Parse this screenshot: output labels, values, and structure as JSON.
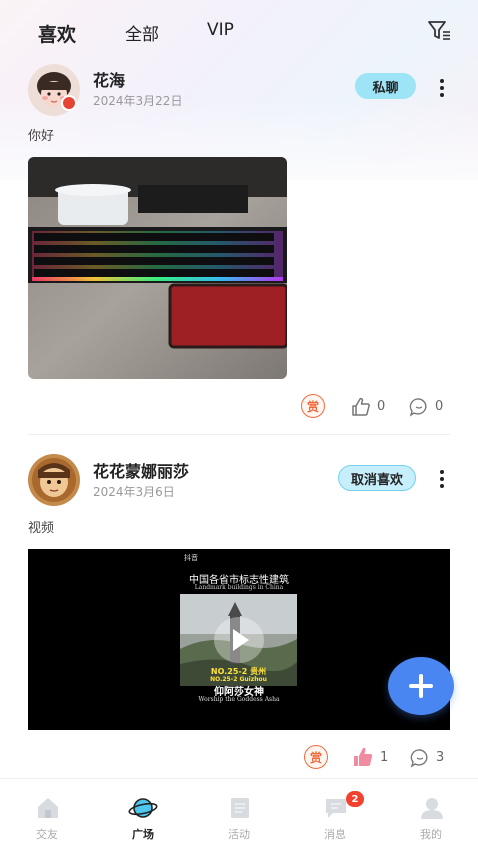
{
  "header": {
    "tabs": [
      {
        "label": "喜欢",
        "active": true
      },
      {
        "label": "全部",
        "active": false
      },
      {
        "label": "VIP",
        "active": false
      }
    ],
    "filter_icon": "filter-icon"
  },
  "posts": [
    {
      "username": "花海",
      "date": "2024年3月22日",
      "action_label": "私聊",
      "text": "你好",
      "media": "keyboard-photo",
      "reward_label": "赏",
      "likes": "0",
      "comments": "0",
      "liked": false
    },
    {
      "username": "花花蒙娜丽莎",
      "date": "2024年3月6日",
      "action_label": "取消喜欢",
      "text": "视频",
      "media": "video",
      "video_title_cn": "中国各省市标志性建筑",
      "video_title_en": "Landmark buildings in China",
      "video_caption_1": "NO.25-2 贵州",
      "video_caption_2": "NO.25-2 Guizhou",
      "video_caption_3": "仰阿莎女神",
      "video_caption_4": "Worship the Goddess Asha",
      "video_brand": "抖音",
      "reward_label": "赏",
      "likes": "1",
      "comments": "3",
      "liked": true
    }
  ],
  "fab": {
    "icon": "plus-icon"
  },
  "bottom_nav": {
    "items": [
      {
        "label": "交友",
        "icon": "home-icon",
        "active": false
      },
      {
        "label": "广场",
        "icon": "planet-icon",
        "active": true
      },
      {
        "label": "活动",
        "icon": "activity-icon",
        "active": false
      },
      {
        "label": "消息",
        "icon": "message-icon",
        "active": false,
        "badge": "2"
      },
      {
        "label": "我的",
        "icon": "profile-icon",
        "active": false
      }
    ]
  },
  "colors": {
    "accent_cyan": "#9ee4f7",
    "fab_blue": "#4a86f2",
    "reward_orange": "#f06b3c",
    "like_pink": "#f28aa0",
    "badge_red": "#f2412e"
  }
}
